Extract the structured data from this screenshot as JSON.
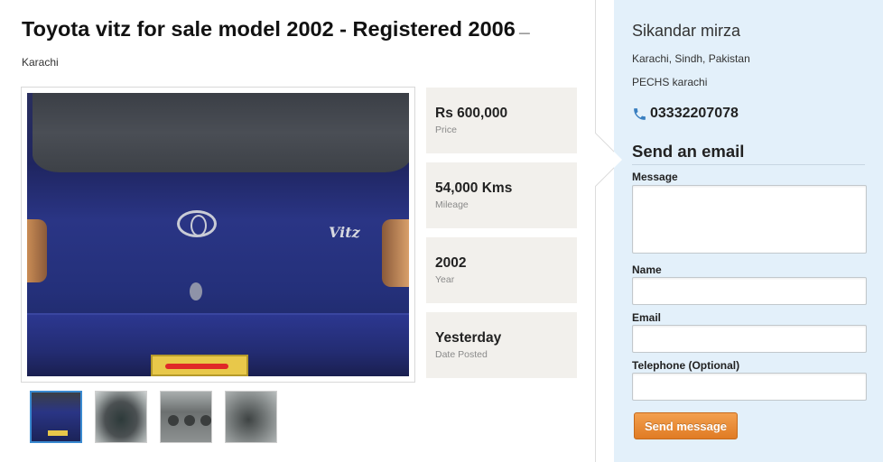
{
  "listing": {
    "title": "Toyota vitz for sale model 2002 - Registered 2006",
    "location": "— Karachi"
  },
  "photos": {
    "main_alt": "Toyota Vitz rear view",
    "thumbnails": [
      "car-rear",
      "dashboard-gauges",
      "ac-vents",
      "steering-controls"
    ],
    "selected_index": 0
  },
  "stats": [
    {
      "value": "Rs 600,000",
      "label": "Price"
    },
    {
      "value": "54,000 Kms",
      "label": "Mileage"
    },
    {
      "value": "2002",
      "label": "Year"
    },
    {
      "value": "Yesterday",
      "label": "Date Posted"
    }
  ],
  "seller": {
    "name": "Sikandar mirza",
    "address_line1": "Karachi, Sindh, Pakistan",
    "address_line2": "PECHS karachi",
    "phone": "03332207078",
    "phone_icon": "phone-icon"
  },
  "email_form": {
    "heading": "Send an email",
    "message_label": "Message",
    "message_value": "",
    "name_label": "Name",
    "name_value": "",
    "email_label": "Email",
    "email_value": "",
    "telephone_label": "Telephone (Optional)",
    "telephone_value": "",
    "submit_label": "Send message"
  },
  "colors": {
    "sidebar_bg": "#e3f0fa",
    "stat_bg": "#f2f0ec",
    "button_orange": "#e88a30",
    "thumb_active_border": "#3a8ad0"
  }
}
